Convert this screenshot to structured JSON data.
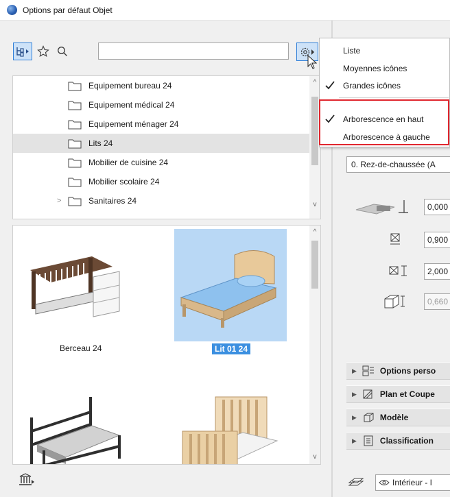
{
  "window": {
    "title": "Options par défaut Objet"
  },
  "toolbar": {
    "search_value": ""
  },
  "tree": {
    "items": [
      {
        "label": "Equipement bureau 24",
        "selected": false,
        "expander": ""
      },
      {
        "label": "Equipement médical 24",
        "selected": false,
        "expander": ""
      },
      {
        "label": "Equipement ménager 24",
        "selected": false,
        "expander": ""
      },
      {
        "label": "Lits 24",
        "selected": true,
        "expander": ""
      },
      {
        "label": "Mobilier de cuisine 24",
        "selected": false,
        "expander": ""
      },
      {
        "label": "Mobilier scolaire 24",
        "selected": false,
        "expander": ""
      },
      {
        "label": "Sanitaires 24",
        "selected": false,
        "expander": ">"
      }
    ]
  },
  "gallery": {
    "items": [
      {
        "label": "Berceau 24",
        "selected": false
      },
      {
        "label": "Lit 01 24",
        "selected": true
      },
      {
        "label": "",
        "selected": false
      },
      {
        "label": "",
        "selected": false
      }
    ]
  },
  "menu": {
    "items": [
      {
        "label": "Liste",
        "checked": false
      },
      {
        "label": "Moyennes icônes",
        "checked": false
      },
      {
        "label": "Grandes icônes",
        "checked": true
      },
      {
        "label": "Arborescence en haut",
        "checked": true
      },
      {
        "label": "Arborescence à gauche",
        "checked": false
      }
    ]
  },
  "right": {
    "floor": "0. Rez-de-chaussée (A",
    "params": [
      {
        "value": "0,000",
        "disabled": false
      },
      {
        "value": "0,900",
        "disabled": false
      },
      {
        "value": "2,000",
        "disabled": false
      },
      {
        "value": "0,660",
        "disabled": true
      }
    ],
    "sections": [
      {
        "label": "Options perso"
      },
      {
        "label": "Plan et Coupe"
      },
      {
        "label": "Modèle"
      },
      {
        "label": "Classification"
      }
    ],
    "view_button": "Intérieur - I"
  },
  "colors": {
    "accent": "#2f7fd8",
    "highlight": "#e0262e",
    "selection": "#b9d8f5"
  }
}
